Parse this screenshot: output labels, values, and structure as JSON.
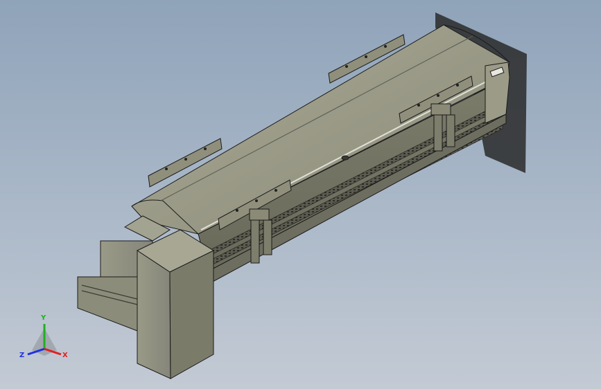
{
  "viewport": {
    "background_top": "#8fa3b9",
    "background_bottom": "#c3cad4",
    "model_face_color": "#8b8b79",
    "model_edge_color": "#1a1a1a"
  },
  "triad": {
    "x_label": "X",
    "y_label": "Y",
    "z_label": "Z",
    "x_color": "#e02020",
    "y_color": "#20b020",
    "z_color": "#2030e0"
  }
}
